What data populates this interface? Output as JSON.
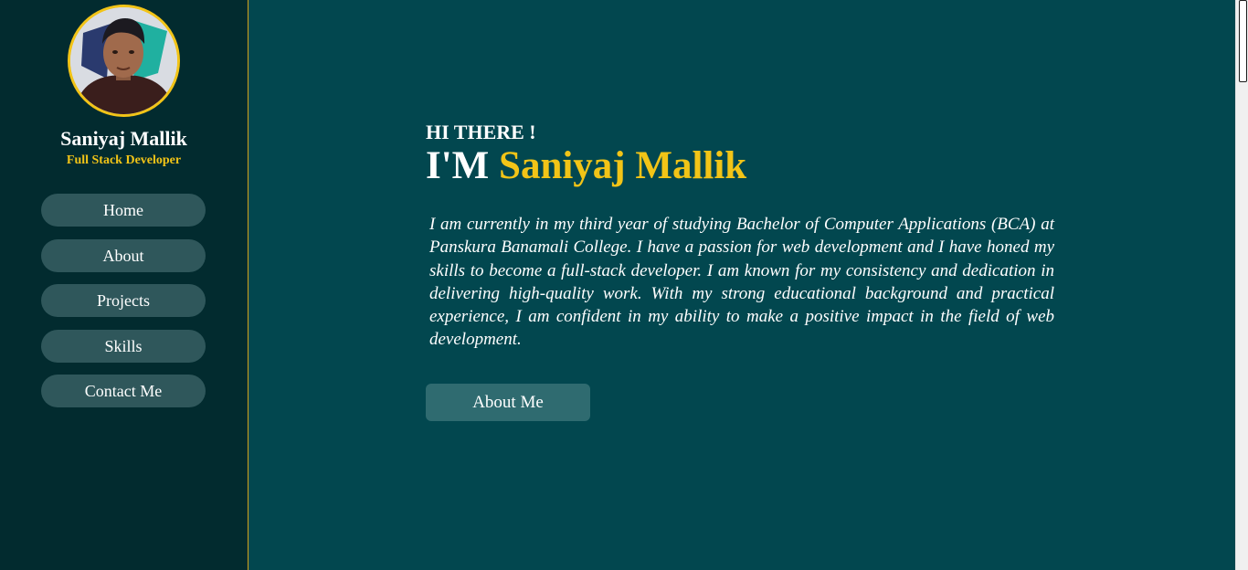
{
  "sidebar": {
    "name": "Saniyaj Mallik",
    "role": "Full Stack Developer",
    "nav": [
      {
        "label": "Home"
      },
      {
        "label": "About"
      },
      {
        "label": "Projects"
      },
      {
        "label": "Skills"
      },
      {
        "label": "Contact Me"
      }
    ]
  },
  "hero": {
    "greeting": "HI THERE !",
    "prefix": "I'M",
    "name": "Saniyaj Mallik",
    "bio": "I am currently in my third year of studying Bachelor of Computer Applications (BCA) at Panskura Banamali College. I have a passion for web development and I have honed my skills to become a full-stack developer. I am known for my consistency and dedication in delivering high-quality work. With my strong educational background and practical experience, I am confident in my ability to make a positive impact in the field of web development.",
    "cta_label": "About Me"
  },
  "colors": {
    "main_bg": "#02474f",
    "sidebar_bg": "#022b2f",
    "accent": "#f2c417",
    "nav_button": "#2f575b",
    "cta_button": "#2f6b70"
  },
  "icons": {
    "avatar": "profile-photo"
  }
}
